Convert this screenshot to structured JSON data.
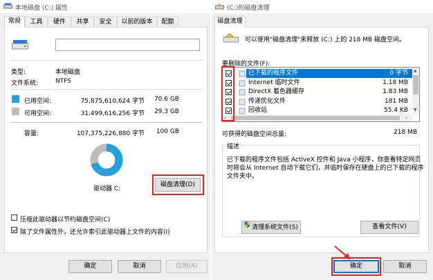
{
  "left": {
    "title": "本地磁盘 (C:) 属性",
    "tabs": [
      "常规",
      "工具",
      "硬件",
      "共享",
      "安全",
      "以前的版本",
      "配额"
    ],
    "drive_name": "",
    "type_label": "类型:",
    "type_value": "本地磁盘",
    "fs_label": "文件系统:",
    "fs_value": "NTFS",
    "used_label": "已用空间:",
    "used_bytes": "75,875,610,624 字节",
    "used_gb": "70.6 GB",
    "free_label": "可用空间:",
    "free_bytes": "31,499,616,256 字节",
    "free_gb": "29.3 GB",
    "cap_label": "容量:",
    "cap_bytes": "107,375,226,880 字节",
    "cap_gb": "100 GB",
    "used_fraction": 0.706,
    "drive_label": "驱动器 C:",
    "cleanup_button": "磁盘清理(D)",
    "compress_label": "压缩此驱动器以节约磁盘空间(C)",
    "index_label": "除了文件属性外，还允许索引此驱动器上文件的内容(I)",
    "ok": "确定",
    "cancel": "取消",
    "apply": "应用(A)",
    "colors": {
      "used": "#26a0da",
      "free": "#bcbcbc"
    }
  },
  "right": {
    "title": "(C:)的磁盘清理",
    "tab": "磁盘清理",
    "intro": "可以使用\"磁盘清理\"来释放 (C:) 上的 218 MB 磁盘空间。",
    "files_label": "要删除的文件(F):",
    "files": [
      {
        "name": "已下载的程序文件",
        "size": "0 字节",
        "checked": true,
        "selected": true
      },
      {
        "name": "Internet 临时文件",
        "size": "1.18 MB",
        "checked": true,
        "selected": false
      },
      {
        "name": "DirectX 着色器缓存",
        "size": "1.83 MB",
        "checked": true,
        "selected": false
      },
      {
        "name": "传递优化文件",
        "size": "181 MB",
        "checked": true,
        "selected": false
      },
      {
        "name": "回收站",
        "size": "55.4 KB",
        "checked": true,
        "selected": false
      }
    ],
    "total_label": "可获得的磁盘空间总量:",
    "total_value": "218 MB",
    "desc_label": "描述",
    "desc_line1": "已下载的程序文件包括 ActiveX 控件和 Java 小程序，你查看特定网页",
    "desc_line2": "时将会从 Internet 自动下载它们，并临时保存在硬盘上的已下载的程序",
    "desc_line3": "文件夹中。",
    "clean_system": "清理系统文件(S)",
    "view_files": "查看文件(V)",
    "ok": "确定",
    "cancel": "取消"
  }
}
